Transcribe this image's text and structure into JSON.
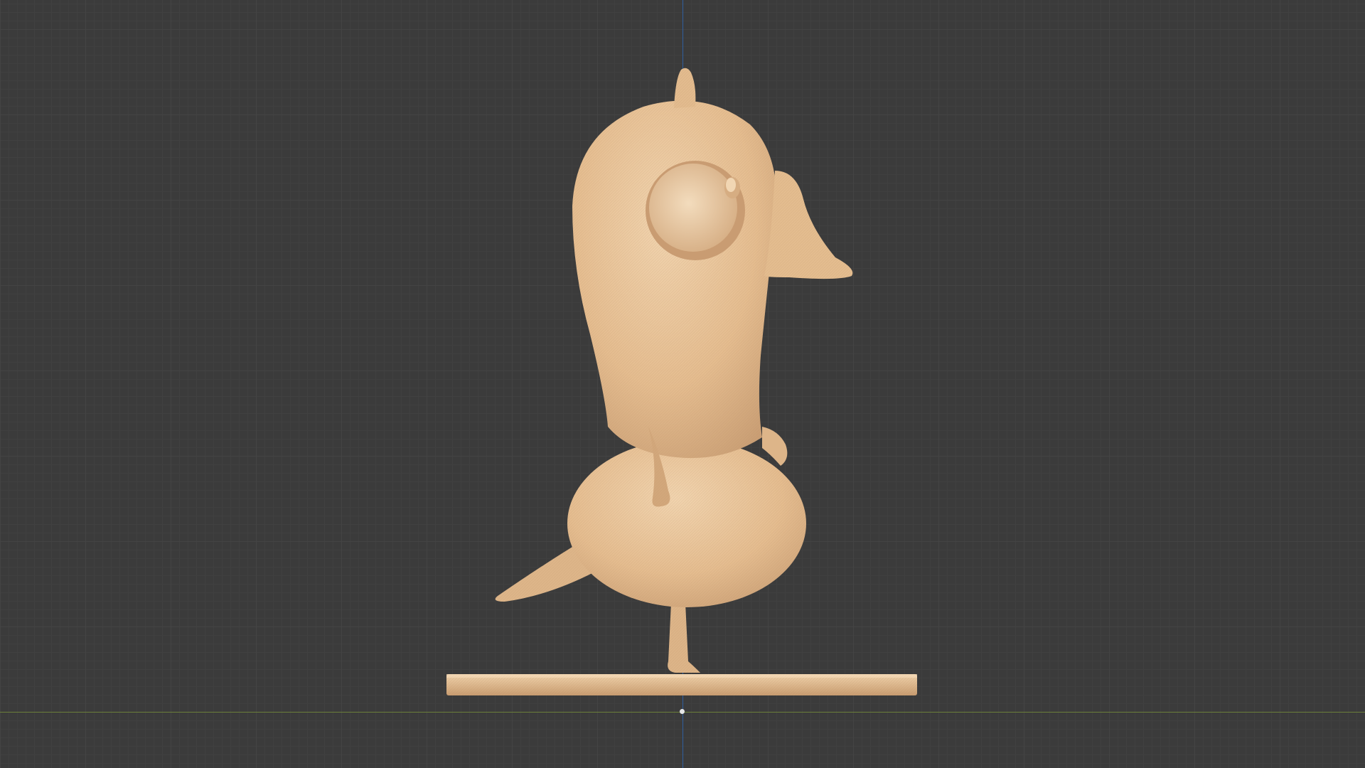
{
  "viewport": {
    "view": "front-orthographic",
    "grid": true,
    "axes": [
      "x-axis-line",
      "z-axis-line"
    ]
  },
  "model": {
    "name": "duck-figurine",
    "shading": "solid-wireframe",
    "colors": {
      "body": "#e8c398",
      "shadow": "#c9a07a",
      "highlight": "#f1d7b5",
      "background": "#3b3b3b"
    }
  }
}
